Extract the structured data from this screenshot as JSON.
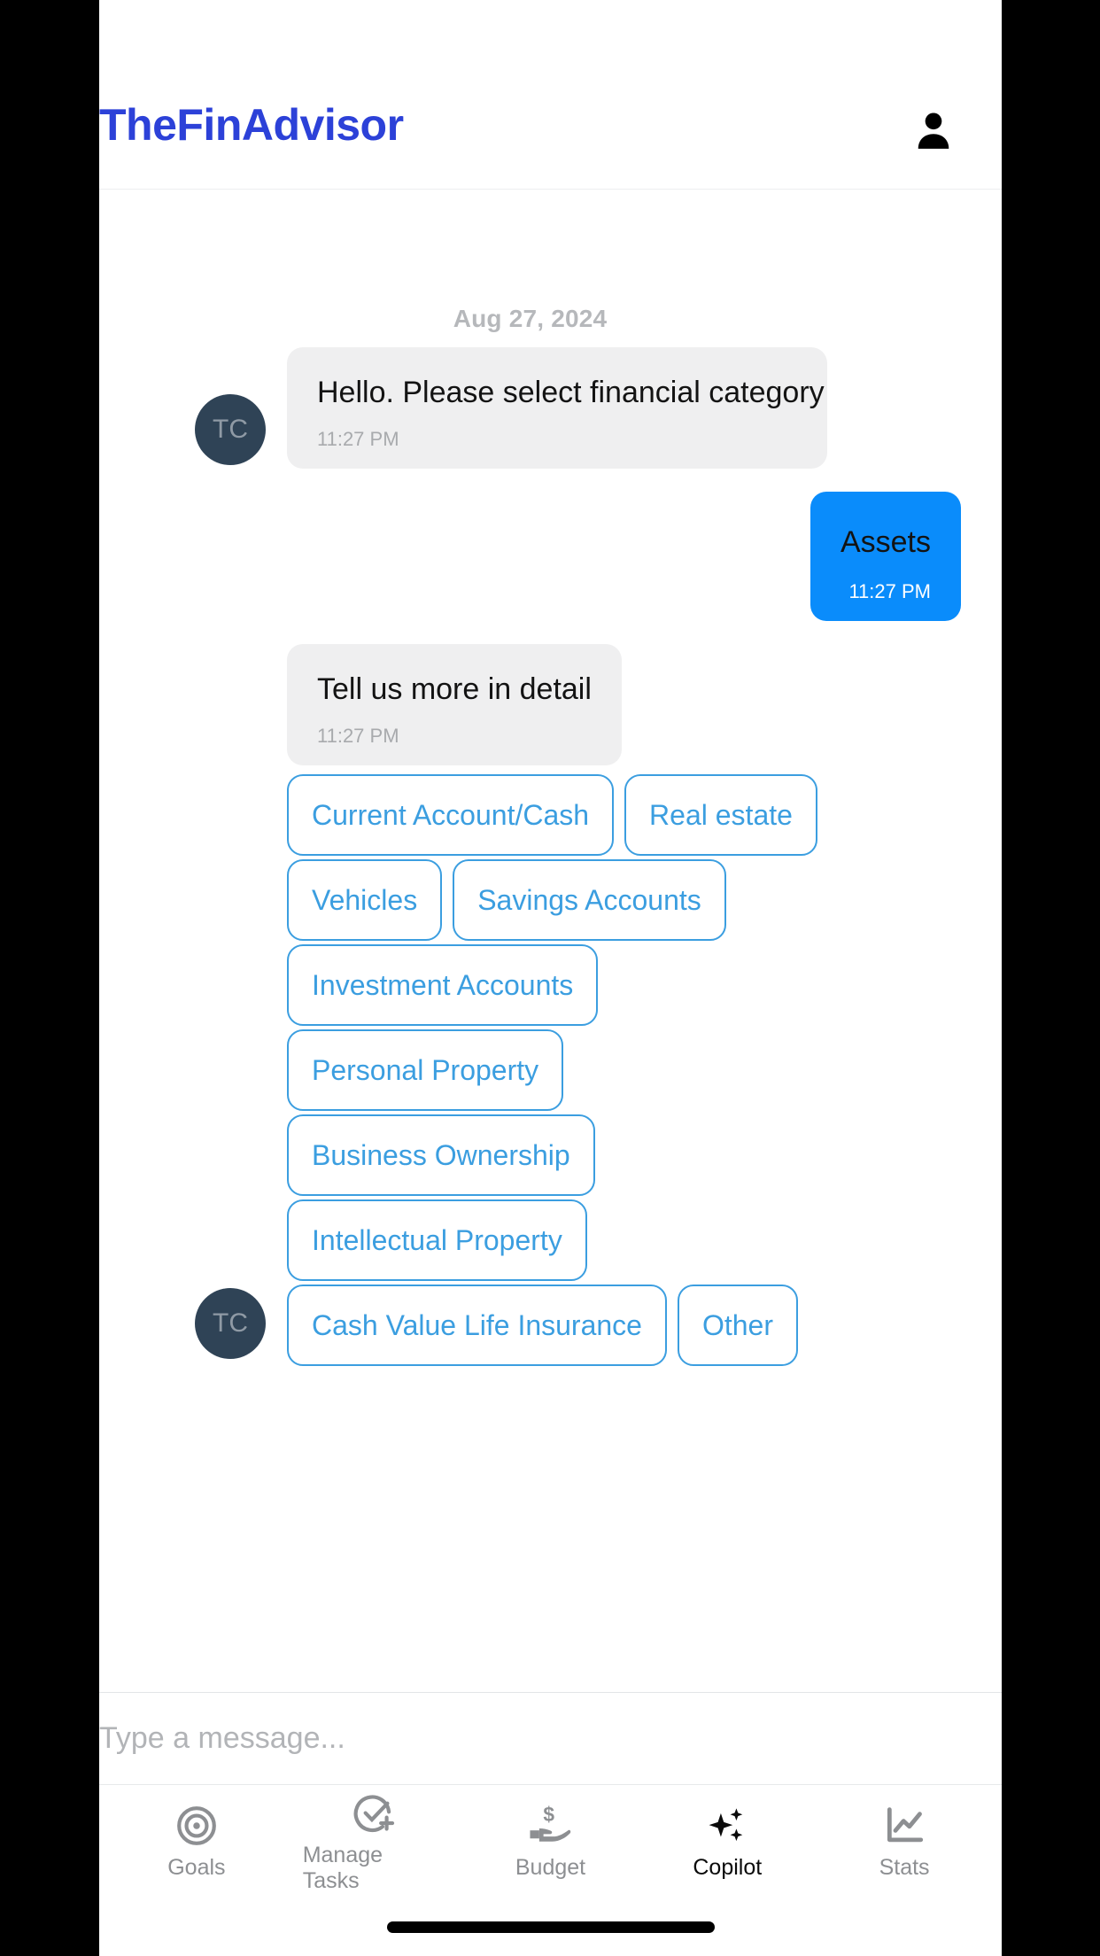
{
  "header": {
    "app_title": "TheFinAdvisor",
    "profile_icon": "person-icon",
    "brand_color": "#2c41d8"
  },
  "chat": {
    "date_divider": "Aug 27, 2024",
    "avatar_initials": "TC",
    "messages": [
      {
        "id": "bot-greeting",
        "sender": "bot",
        "text": "Hello. Please select financial category",
        "time": "11:27 PM"
      },
      {
        "id": "user-assets",
        "sender": "user",
        "text": "Assets",
        "time": "11:27 PM"
      },
      {
        "id": "bot-detail",
        "sender": "bot",
        "text": "Tell us more in detail",
        "time": "11:27 PM"
      }
    ],
    "quick_replies": [
      [
        "Current Account/Cash",
        "Real estate"
      ],
      [
        "Vehicles",
        "Savings Accounts"
      ],
      [
        "Investment Accounts"
      ],
      [
        "Personal Property"
      ],
      [
        "Business Ownership"
      ],
      [
        "Intellectual Property"
      ],
      [
        "Cash Value Life Insurance",
        "Other"
      ]
    ],
    "chip_color": "#3b9ee0",
    "bot_bubble_color": "#efeff0",
    "user_bubble_color": "#0a8cfb"
  },
  "composer": {
    "placeholder": "Type a message...",
    "value": ""
  },
  "bottom_nav": {
    "items": [
      {
        "label": "Goals",
        "icon": "target-icon",
        "active": false
      },
      {
        "label": "Manage Tasks",
        "icon": "check-circle-plus-icon",
        "active": false
      },
      {
        "label": "Budget",
        "icon": "hand-dollar-icon",
        "active": false
      },
      {
        "label": "Copilot",
        "icon": "sparkles-icon",
        "active": true
      },
      {
        "label": "Stats",
        "icon": "line-chart-icon",
        "active": false
      }
    ],
    "inactive_color": "#8d8f92",
    "active_color": "#0b0b0b"
  }
}
